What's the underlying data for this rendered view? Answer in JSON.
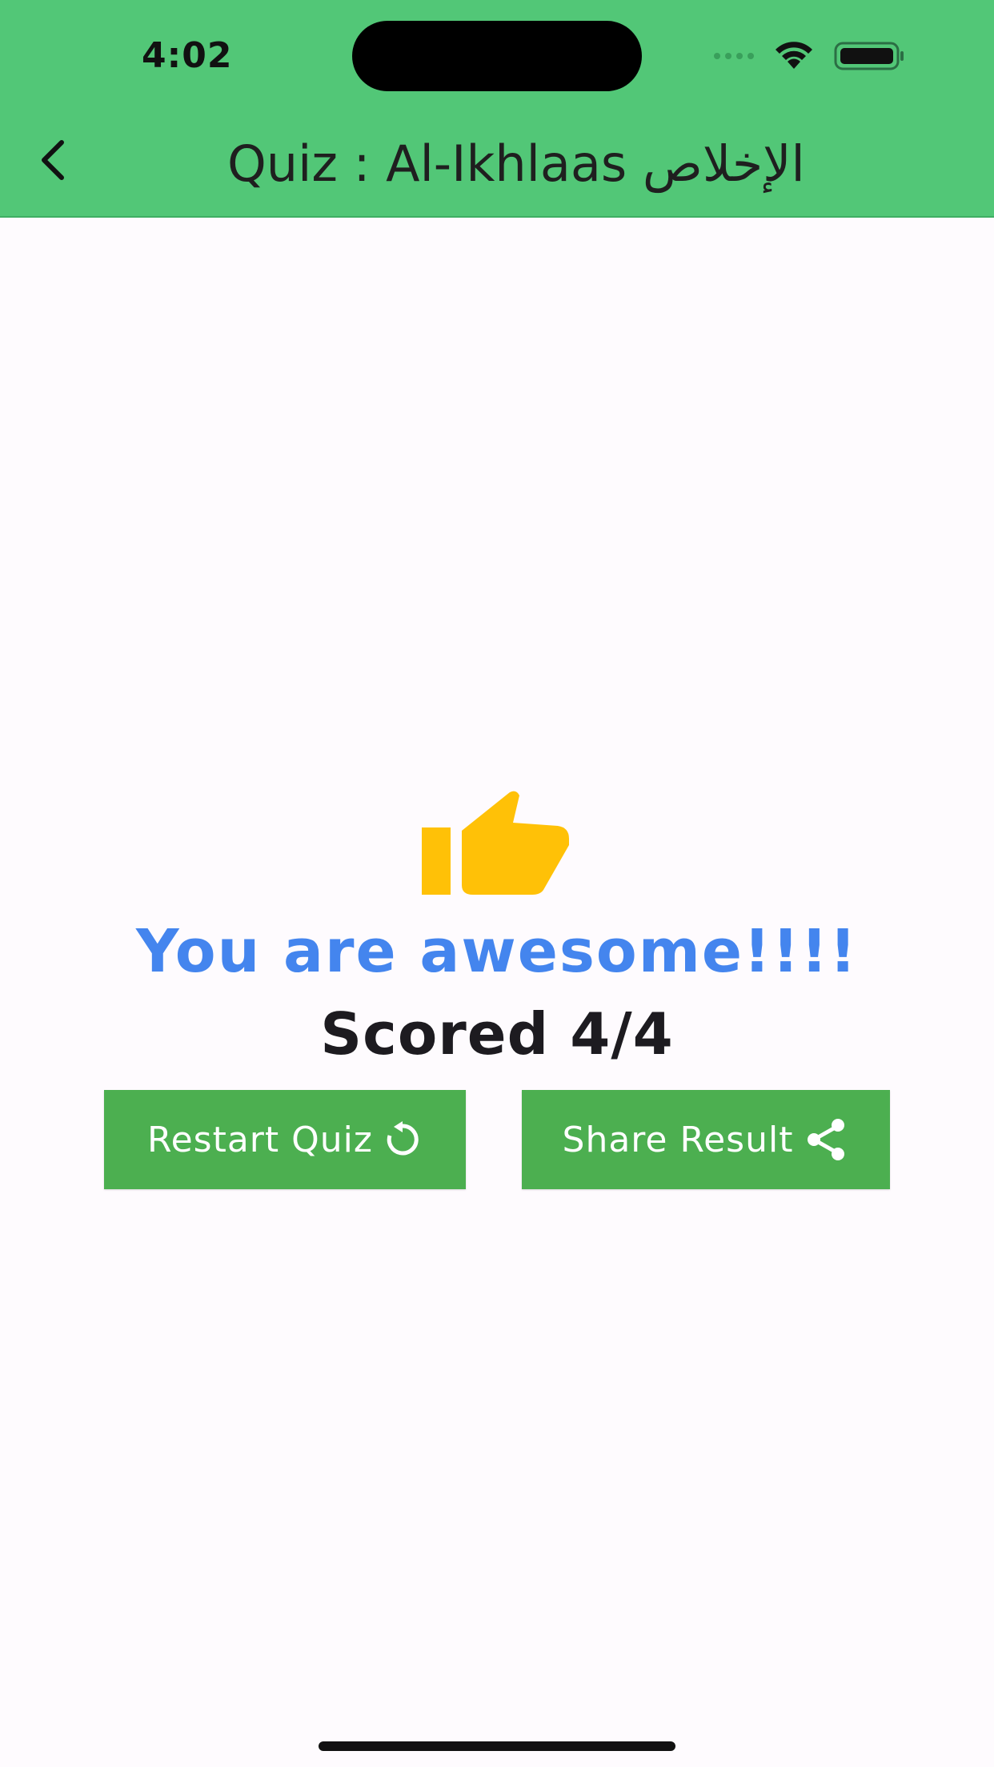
{
  "status_bar": {
    "time": "4:02"
  },
  "app_bar": {
    "title": "Quiz : Al-Ikhlaas الإخلاص"
  },
  "result": {
    "message": "You are awesome!!!!",
    "score": "Scored 4/4"
  },
  "buttons": {
    "restart_label": "Restart Quiz",
    "share_label": "Share Result"
  },
  "icons": {
    "back": "chevron-left-icon",
    "thumb": "thumbs-up-icon",
    "restart": "refresh-icon",
    "share": "share-icon",
    "wifi": "wifi-icon",
    "battery": "battery-icon"
  },
  "colors": {
    "app_bar": "#52c777",
    "button": "#4caf50",
    "message": "#4485ee",
    "thumb": "#ffc107"
  }
}
